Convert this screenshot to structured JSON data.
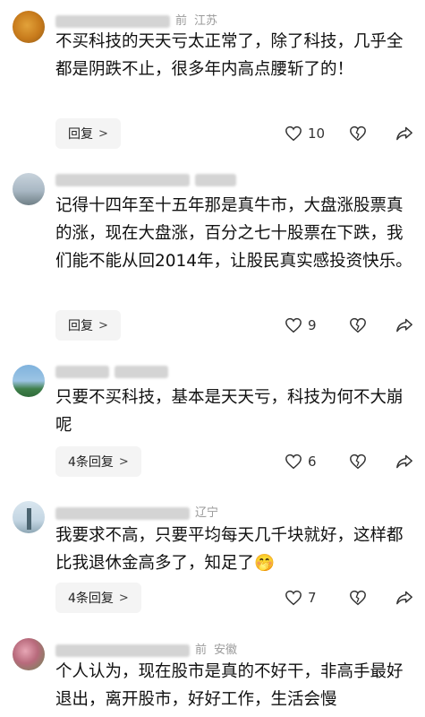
{
  "comments": [
    {
      "meta_time": "前",
      "location": "江苏",
      "text": "不买科技的天天亏太正常了，除了科技，几乎全都是阴跌不止，很多年内高点腰斩了的！",
      "reply_label": "回复",
      "likes": "10"
    },
    {
      "meta_time": "",
      "location": "",
      "text": "记得十四年至十五年那是真牛市，大盘涨股票真的涨，现在大盘涨，百分之七十股票在下跌，我们能不能从回2014年，让股民真实感投资快乐。",
      "reply_label": "回复",
      "likes": "9"
    },
    {
      "meta_time": "",
      "location": "",
      "text": "只要不买科技，基本是天天亏，科技为何不大崩呢",
      "reply_label": "4条回复",
      "likes": "6"
    },
    {
      "meta_time": "",
      "location": "辽宁",
      "text": "我要求不高，只要平均每天几千块就好，这样都比我退休金高多了，知足了🤭",
      "reply_label": "4条回复",
      "likes": "7"
    },
    {
      "meta_time": "前",
      "location": "安徽",
      "text": "个人认为，现在股市是真的不好干，非高手最好退出，离开股市，好好工作，生活会慢"
    }
  ],
  "icons": {
    "like": "heart-outline-icon",
    "dislike": "broken-heart-icon",
    "share": "share-arrow-icon",
    "chevron": "chevron-right-icon"
  },
  "colors": {
    "meta": "#9a9a9a",
    "reply_bg": "#f4f4f4",
    "text": "#111111"
  }
}
